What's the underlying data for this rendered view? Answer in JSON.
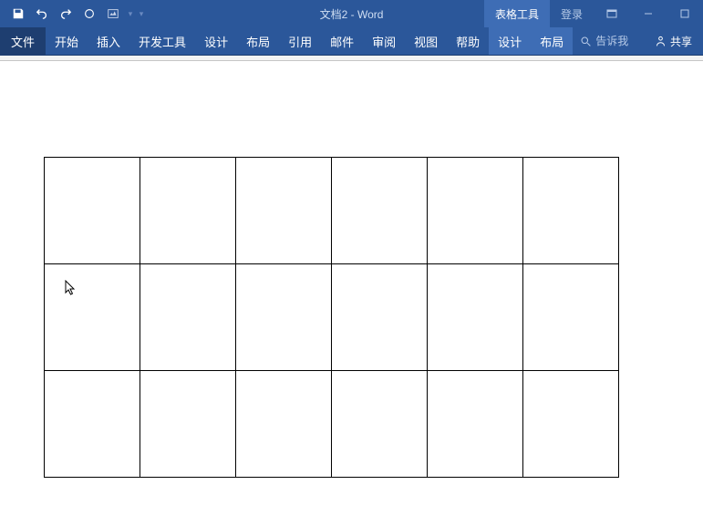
{
  "title": {
    "doc_name": "文档2",
    "separator": " - ",
    "app_name": "Word"
  },
  "qat": {
    "save_title": "保存",
    "undo_title": "撤销",
    "redo_title": "重做",
    "start_title": "从头开始",
    "touch_title": "触摸/鼠标模式",
    "customize_title": "自定义快速访问工具栏"
  },
  "context_group": {
    "label": "表格工具"
  },
  "login": {
    "label": "登录"
  },
  "win": {
    "restore_title": "向下还原",
    "min_title": "最小化",
    "max_title": "最大化"
  },
  "ribbon": {
    "file": "文件",
    "tabs": [
      "开始",
      "插入",
      "开发工具",
      "设计",
      "布局",
      "引用",
      "邮件",
      "审阅",
      "视图",
      "帮助"
    ],
    "context_tabs": [
      "设计",
      "布局"
    ],
    "tell_me_placeholder": "告诉我",
    "share": "共享"
  },
  "table": {
    "rows": 3,
    "cols": 6
  }
}
